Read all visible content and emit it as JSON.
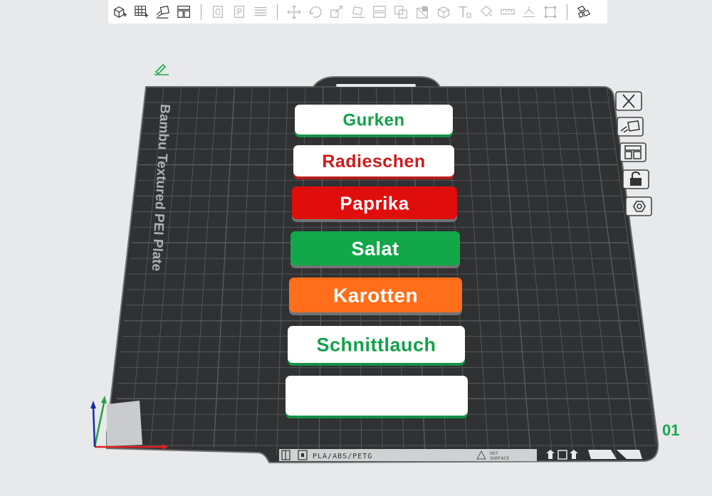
{
  "toolbar": {
    "icons": [
      "add-object-icon",
      "add-plate-icon",
      "auto-orient-icon",
      "arrange-icon",
      "empty-box-icon",
      "p-box-icon",
      "layers-icon",
      "move-icon",
      "rotate-icon",
      "scale-icon",
      "lay-on-face-icon",
      "split-icon",
      "boolean-icon",
      "cut-icon",
      "support-paint-icon",
      "text-tool-icon",
      "color-paint-icon",
      "measure-icon",
      "seam-paint-icon",
      "assembly-icon",
      "view-assembly-icon"
    ]
  },
  "plate": {
    "name": "Bambu Textured PEI Plate",
    "material_text": "PLA/ABS/PETG",
    "hot_surface_line1": "HOT",
    "hot_surface_line2": "SURFACE",
    "number": "01"
  },
  "labels": [
    {
      "text": "Gurken",
      "bg": "#ffffff",
      "fg": "#12a14a"
    },
    {
      "text": "Radieschen",
      "bg": "#ffffff",
      "fg": "#d01a1a"
    },
    {
      "text": "Paprika",
      "bg": "#e00d0d",
      "fg": "#ffffff"
    },
    {
      "text": "Salat",
      "bg": "#12a84a",
      "fg": "#ffffff"
    },
    {
      "text": "Karotten",
      "bg": "#ff6e1a",
      "fg": "#ffffff"
    },
    {
      "text": "Schnittlauch",
      "bg": "#ffffff",
      "fg": "#12a14a"
    },
    {
      "text": "",
      "bg": "#ffffff",
      "fg": "#12a14a"
    }
  ],
  "colors": {
    "plate_dark": "#3a3c3d",
    "grid_line": "#5b5d5e",
    "accent_green": "#1aa84c",
    "background": "#e8e9ea"
  }
}
